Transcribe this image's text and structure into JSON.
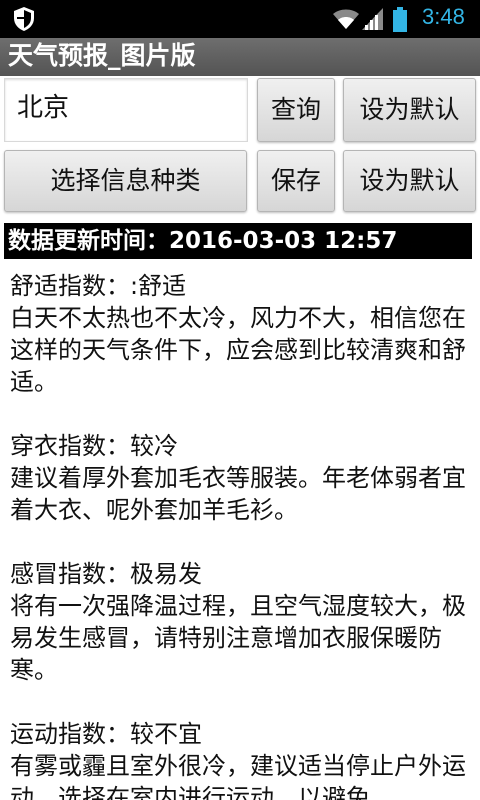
{
  "status_bar": {
    "time": "3:48"
  },
  "title_bar": {
    "title": "天气预报_图片版"
  },
  "form": {
    "city_value": "北京",
    "query_label": "查询",
    "set_default_label_1": "设为默认",
    "select_type_label": "选择信息种类",
    "save_label": "保存",
    "set_default_label_2": "设为默认"
  },
  "update": {
    "label": "数据更新时间：2016-03-03 12:57"
  },
  "sections": [
    {
      "title": "舒适指数：:舒适",
      "body": "白天不太热也不太冷，风力不大，相信您在这样的天气条件下，应会感到比较清爽和舒适。"
    },
    {
      "title": "穿衣指数：较冷",
      "body": "建议着厚外套加毛衣等服装。年老体弱者宜着大衣、呢外套加羊毛衫。"
    },
    {
      "title": "感冒指数：极易发",
      "body": "将有一次强降温过程，且空气湿度较大，极易发生感冒，请特别注意增加衣服保暖防寒。"
    },
    {
      "title": "运动指数：较不宜",
      "body": "有雾或霾且室外很冷，建议适当停止户外运动，选择在室内进行运动，以避免"
    }
  ],
  "colors": {
    "status_bar_bg": "#000000",
    "clock": "#33b5e5",
    "title_bar_bg": "#5f5f5f"
  },
  "icons": {
    "notification": "shield-icon",
    "wifi": "wifi-icon",
    "signal": "signal-icon",
    "battery": "battery-icon"
  }
}
